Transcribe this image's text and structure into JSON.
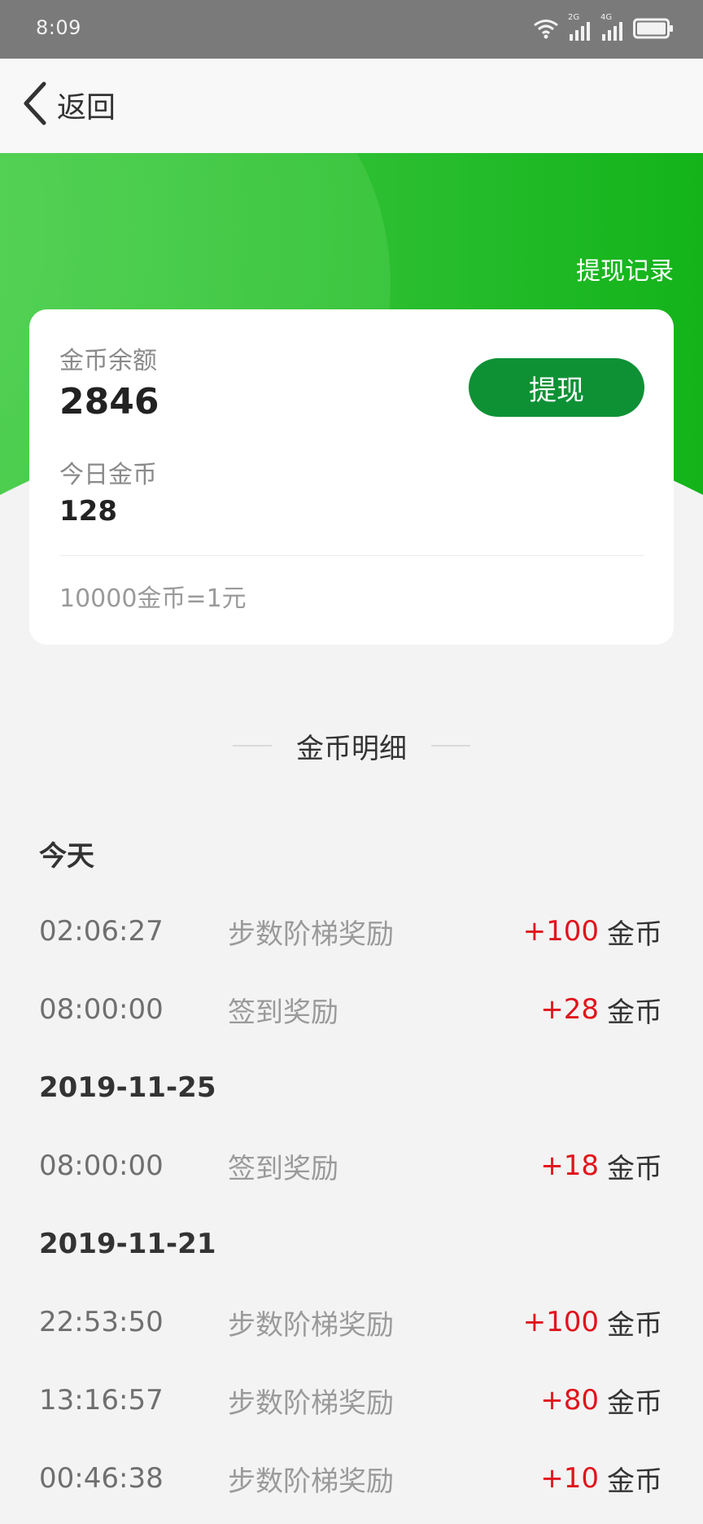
{
  "status_bar": {
    "time": "8:09",
    "signal_1_label": "2G",
    "signal_2_label": "4G"
  },
  "nav": {
    "back_label": "返回"
  },
  "header": {
    "withdraw_record_label": "提现记录"
  },
  "card": {
    "balance_label": "金币余额",
    "balance_value": "2846",
    "today_label": "今日金币",
    "today_value": "128",
    "withdraw_button_label": "提现",
    "rate_text": "10000金币=1元"
  },
  "section": {
    "title": "金币明细"
  },
  "history": {
    "unit": "金币",
    "groups": [
      {
        "date": "今天",
        "items": [
          {
            "time": "02:06:27",
            "desc": "步数阶梯奖励",
            "amount": "+100"
          },
          {
            "time": "08:00:00",
            "desc": "签到奖励",
            "amount": "+28"
          }
        ]
      },
      {
        "date": "2019-11-25",
        "items": [
          {
            "time": "08:00:00",
            "desc": "签到奖励",
            "amount": "+18"
          }
        ]
      },
      {
        "date": "2019-11-21",
        "items": [
          {
            "time": "22:53:50",
            "desc": "步数阶梯奖励",
            "amount": "+100"
          },
          {
            "time": "13:16:57",
            "desc": "步数阶梯奖励",
            "amount": "+80"
          },
          {
            "time": "00:46:38",
            "desc": "步数阶梯奖励",
            "amount": "+10"
          }
        ]
      }
    ]
  },
  "colors": {
    "brand_green": "#1fbf2d",
    "button_green": "#0e9135",
    "amount_red": "#e0131c"
  },
  "icons": {
    "back": "chevron-left-icon",
    "wifi": "wifi-icon",
    "battery": "battery-icon"
  }
}
